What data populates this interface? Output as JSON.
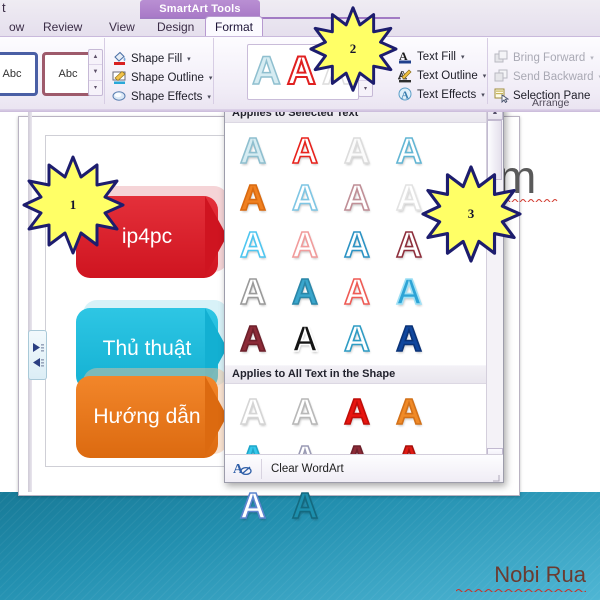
{
  "app": {
    "contextual_tab_title": "SmartArt Tools",
    "tabs": [
      {
        "label": "ow",
        "active": false
      },
      {
        "label": "Review",
        "active": false
      },
      {
        "label": "View",
        "active": false
      },
      {
        "label": "Design",
        "active": false
      },
      {
        "label": "Format",
        "active": true
      }
    ],
    "left_clipped_label": "t"
  },
  "ribbon": {
    "shape_styles": {
      "thumb_1_text": "Abc",
      "thumb_2_text": "Abc",
      "scroll_up": "▲",
      "scroll_down": "▼",
      "scroll_more": "▾"
    },
    "shape_commands": [
      {
        "label": "Shape Fill",
        "caret": "▾",
        "icon": "paint-bucket-icon",
        "disabled": false
      },
      {
        "label": "Shape Outline",
        "caret": "▾",
        "icon": "pencil-outline-icon",
        "disabled": false
      },
      {
        "label": "Shape Effects",
        "caret": "▾",
        "icon": "shape-effects-icon",
        "disabled": false
      }
    ],
    "text_commands": [
      {
        "label": "Text Fill",
        "caret": "▾",
        "icon": "text-fill-icon",
        "disabled": false
      },
      {
        "label": "Text Outline",
        "caret": "▾",
        "icon": "text-outline-icon",
        "disabled": false
      },
      {
        "label": "Text Effects",
        "caret": "▾",
        "icon": "text-effects-icon",
        "disabled": false
      }
    ],
    "arrange_commands": [
      {
        "label": "Bring Forward",
        "caret": "▾",
        "icon": "bring-forward-icon",
        "disabled": true
      },
      {
        "label": "Send Backward",
        "caret": "▾",
        "icon": "send-backward-icon",
        "disabled": true
      },
      {
        "label": "Selection Pane",
        "caret": "",
        "icon": "selection-pane-icon",
        "disabled": false
      }
    ],
    "arrange_group_label": "Arrange",
    "wordart_quick": {
      "letter": "A",
      "swatch_colors": [
        "#bfe3ef",
        "#e02020",
        "#e9e9ea"
      ]
    }
  },
  "wordart_gallery": {
    "section_selected_label": "Applies to Selected Text",
    "section_all_label": "Applies to All Text in the Shape",
    "clear_label": "Clear WordArt",
    "clear_icon": "clear-wordart-icon",
    "letter": "A",
    "scroll_up": "▲",
    "scroll_down": "▼",
    "selected_rows": [
      [
        {
          "fill": "#d6ecf2",
          "stroke": "#8fbfcf"
        },
        {
          "fill": "#ffffff",
          "stroke": "#e8221c"
        },
        {
          "fill": "#fbfbfb",
          "stroke": "#dcdcdc"
        },
        {
          "fill": "#ffffff",
          "stroke": "#63b6d4"
        },
        {
          "fill": "#f08020",
          "stroke": "#d96a10"
        }
      ],
      [
        {
          "fill": "#ffffff",
          "stroke": "#7fc6e4"
        },
        {
          "fill": "#ffffff",
          "stroke": "#c08f97"
        },
        {
          "fill": "#ffffff",
          "stroke": "#e3e3e3"
        },
        {
          "fill": "#ffffff",
          "stroke": "#4fc6f0"
        },
        {
          "fill": "#ffffff",
          "stroke": "#f19c9c"
        }
      ],
      [
        {
          "fill": "#ffffff",
          "stroke": "#2c93c4"
        },
        {
          "fill": "#ffffff",
          "stroke": "#8e2f3c"
        },
        {
          "fill": "#ffffff",
          "stroke": "#9a9a9a"
        },
        {
          "fill": "#3aa6cc",
          "stroke": "#2a86a8"
        },
        {
          "fill": "#ffffff",
          "stroke": "#ef5b55"
        }
      ],
      [
        {
          "fill": "#2ea4d6",
          "stroke": "#9fe0f5"
        },
        {
          "fill": "#8c2b38",
          "stroke": "#6d202b"
        },
        {
          "fill": "#141414",
          "stroke": "#ffffff"
        },
        {
          "fill": "#ffffff",
          "stroke": "#2f9cc4"
        },
        {
          "fill": "#10479e",
          "stroke": "#0b3377"
        }
      ]
    ],
    "all_rows": [
      [
        {
          "fill": "#ffffff",
          "stroke": "#d5d5d5"
        },
        {
          "fill": "#ffffff",
          "stroke": "#b8b8b8"
        },
        {
          "fill": "#e8150f",
          "stroke": "#bf0d08"
        },
        {
          "fill": "#f08a27",
          "stroke": "#d2711a"
        },
        {
          "fill": "#36c7ea",
          "stroke": "#1fa6c9"
        }
      ],
      [
        {
          "fill": "#ffffff",
          "stroke": "#9a9ab4"
        },
        {
          "fill": "#8c2b38",
          "stroke": "#6d202b"
        },
        {
          "fill": "#e01a14",
          "stroke": "#a8100b"
        },
        {
          "fill": "#ffffff",
          "stroke": "#5d85cf"
        },
        {
          "fill": "#1d8fad",
          "stroke": "#14697f"
        }
      ]
    ]
  },
  "smartart": {
    "shapes": [
      {
        "text": "ip4pc",
        "color": "#d91f2b",
        "dark": "#b0141f"
      },
      {
        "text": "Thủ thuật",
        "color": "#1fb6d8",
        "dark": "#179bb9"
      },
      {
        "text": "Hướng dẫn",
        "color": "#e8741a",
        "dark": "#c75c0e"
      }
    ],
    "pane_handle_icon": "text-pane-toggle-icon"
  },
  "slide": {
    "title_fragment": "m"
  },
  "callouts": [
    {
      "number": "1"
    },
    {
      "number": "2"
    },
    {
      "number": "3"
    }
  ],
  "watermark": {
    "text": "Nobi Rua"
  },
  "status": {
    "dots": "· · · ·"
  },
  "colors": {
    "contextual_tab": "#a879c7",
    "ribbon_bg": "#f1edf7",
    "band_teal": "#1e8aa8",
    "callout_fill": "#ffff66",
    "callout_stroke": "#1d1d6e",
    "watermark": "#6b3b30"
  }
}
